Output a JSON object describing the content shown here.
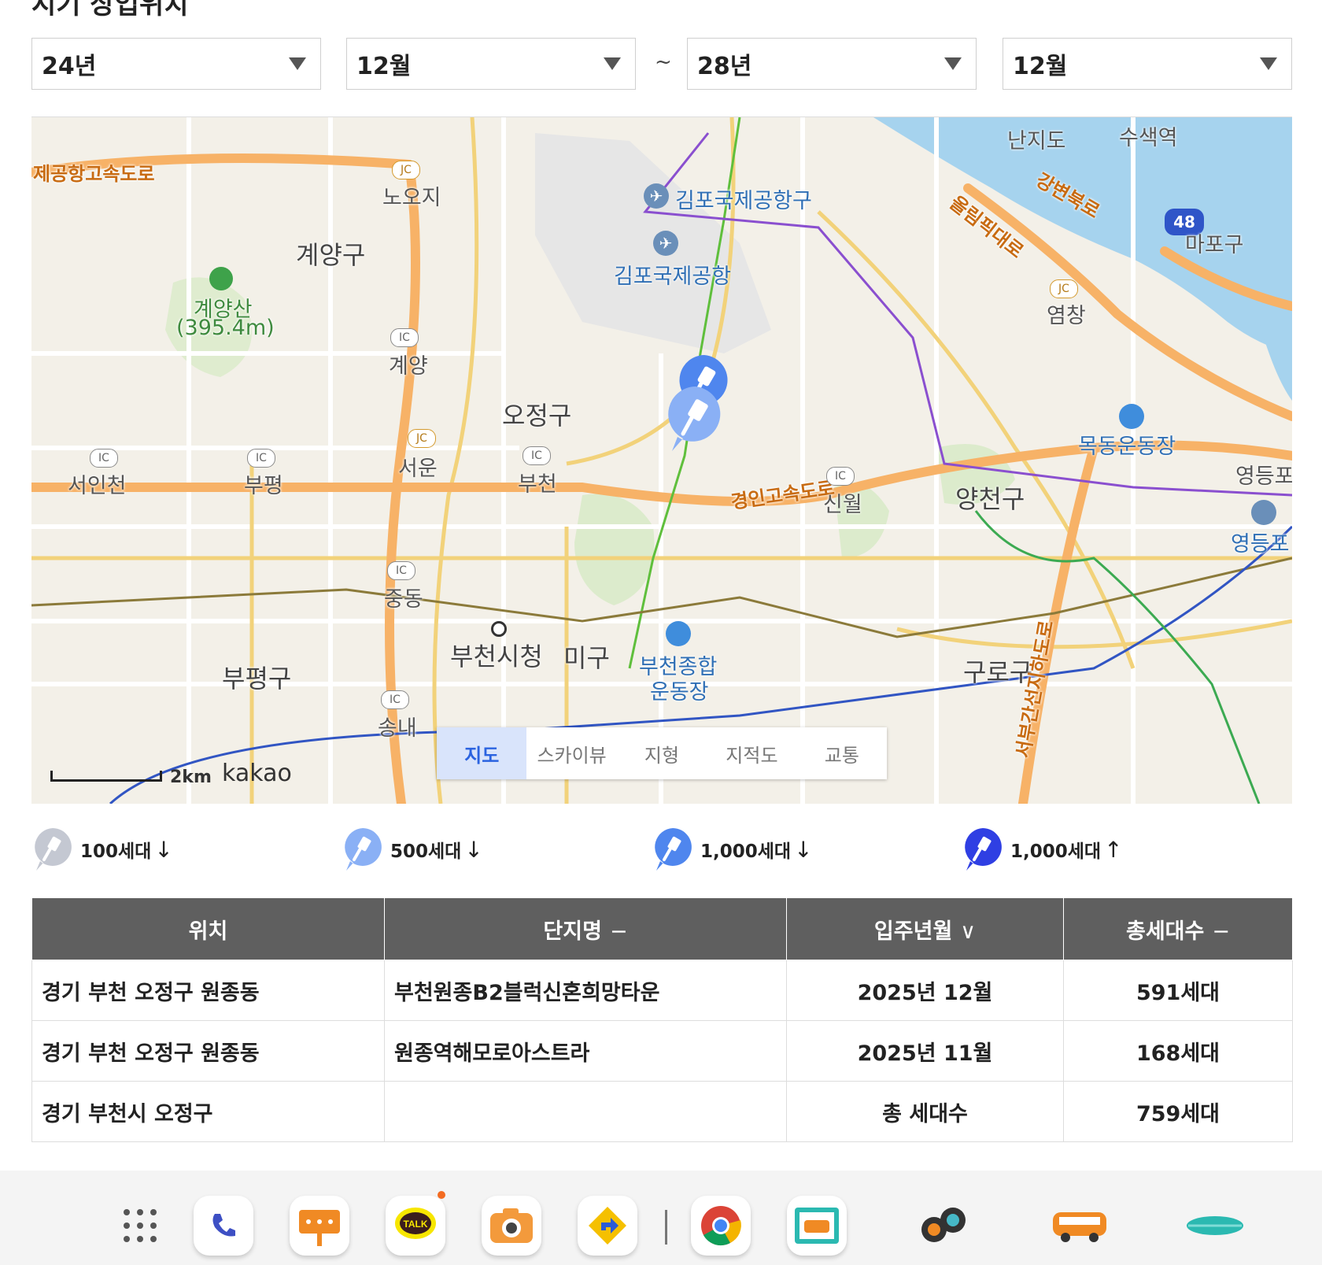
{
  "page": {
    "heading": "시기 상업위치"
  },
  "period": {
    "from_year": "24년",
    "from_month": "12월",
    "separator": "~",
    "to_year": "28년",
    "to_month": "12월"
  },
  "map": {
    "labels": {
      "incheon_airport_road": "제공항고속도로",
      "nooji": "노오지",
      "gyeyang_gu": "계양구",
      "gyeyangsan": "계양산",
      "gyeyangsan_height": "(395.4m)",
      "gyeyang": "계양",
      "gimpo_airport_gu": "김포국제공항구",
      "gimpo_airport": "김포국제공항",
      "nanjido": "난지도",
      "susaek": "수색역",
      "gangbyeon_road": "강변북로",
      "olympic_road": "올림픽대로",
      "route_48": "48",
      "mapo": "마포구",
      "yeomchang": "염창",
      "ojeong_gu": "오정구",
      "seoincheon": "서인천",
      "bupyeong": "부평",
      "seoun": "서운",
      "bucheon": "부천",
      "gyeongin_expressway": "경인고속도로",
      "sinwol": "신월",
      "yangcheon_gu": "양천구",
      "mokdong_stadium": "목동운동장",
      "yeongdeungpo": "영등포",
      "yeongdeungpo2": "영등포",
      "jungdong": "중동",
      "bucheon_cityhall": "부천시청",
      "sosa_gu": "미구",
      "bucheon_stadium": "부천종합",
      "bucheon_stadium2": "운동장",
      "bupyeong_gu": "부평구",
      "guro_gu": "구로구",
      "west_arterial": "서부간선지하도로",
      "songnae": "송내",
      "ic": "IC",
      "jc": "JC"
    },
    "tabs": [
      "지도",
      "스카이뷰",
      "지형",
      "지적도",
      "교통"
    ],
    "active_tab": "지도",
    "scale_label": "2km",
    "provider": "kakao"
  },
  "legend": [
    {
      "label": "100세대",
      "arrow": "↓",
      "color": "#c4c8d2"
    },
    {
      "label": "500세대",
      "arrow": "↓",
      "color": "#8ab0f5"
    },
    {
      "label": "1,000세대",
      "arrow": "↓",
      "color": "#4f86ee"
    },
    {
      "label": "1,000세대",
      "arrow": "↑",
      "color": "#2f3fe3"
    }
  ],
  "table": {
    "headers": [
      "위치",
      "단지명",
      "입주년월",
      "총세대수"
    ],
    "header_sort": [
      "−",
      "∨",
      "−"
    ],
    "rows": [
      {
        "location": "경기 부천 오정구 원종동",
        "name": "부천원종B2블럭신혼희망타운",
        "move_in": "2025년 12월",
        "units": "591세대"
      },
      {
        "location": "경기 부천 오정구 원종동",
        "name": "원종역해모로아스트라",
        "move_in": "2025년 11월",
        "units": "168세대"
      }
    ],
    "total": {
      "location": "경기 부천시 오정구",
      "label": "총 세대수",
      "units": "759세대"
    }
  },
  "colors": {
    "header_bg": "#5f5f5f",
    "active_tab_bg": "#d9e4fb",
    "active_tab_text": "#2b63e0",
    "river": "#a6d3ee",
    "expressway": "#f7b267"
  },
  "dock": {
    "apps": [
      "app-drawer-icon",
      "phone-icon",
      "signboard-icon",
      "kakaotalk-icon",
      "camera-icon",
      "navigation-icon",
      "chrome-icon",
      "van-frame-icon",
      "speaker-icon",
      "camper-van-icon",
      "surfboard-icon"
    ],
    "kakaotalk_label": "TALK"
  }
}
